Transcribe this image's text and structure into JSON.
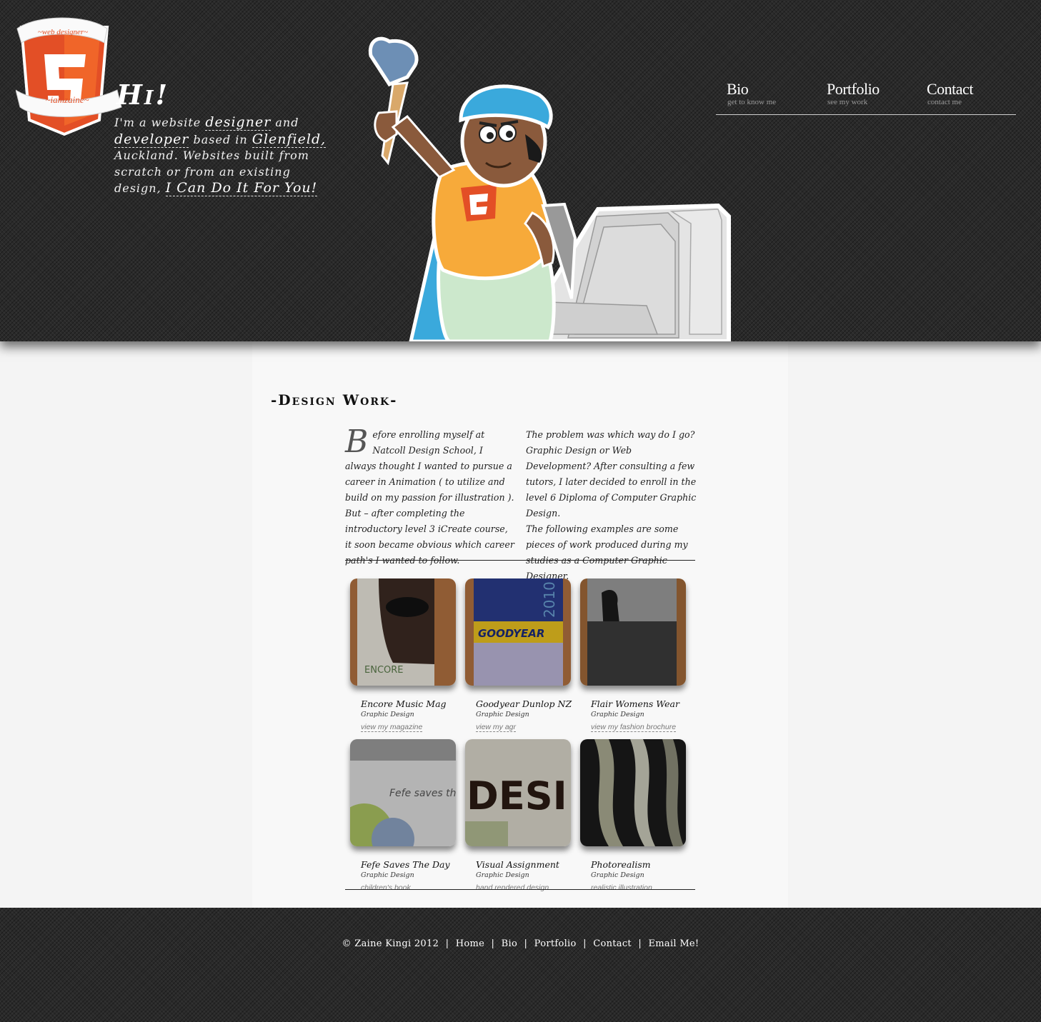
{
  "header": {
    "logo": {
      "ribbon_top": "~web designer~",
      "ribbon_bottom": "~iamzaine~"
    },
    "greeting": "Hi!",
    "intro": {
      "p1": "I'm a website ",
      "designer": "designer",
      "p2": " and ",
      "developer": "developer",
      "p3": " based in ",
      "glenfield": "Glenfield,",
      "p4": " Auckland. Websites built from scratch or from an existing design, ",
      "cta": "I Can Do It For You!"
    }
  },
  "nav": [
    {
      "label": "Bio",
      "sub": "get to know me"
    },
    {
      "label": "Portfolio",
      "sub": "see my work"
    },
    {
      "label": "Contact",
      "sub": "contact me"
    }
  ],
  "section": {
    "title": "-Design Work-",
    "col_left_dropcap": "B",
    "col_left": "efore enrolling myself at Natcoll Design School, I always thought I wanted to pursue a career in Animation ( to utilize and build on my passion for illustration ). But – after completing the introductory level 3 iCreate course, it soon became obvious which career path's I wanted to follow.",
    "col_right_1": "The problem was which way do I go? Graphic Design or Web Development? After consulting a few tutors, I later decided to enroll in the level 6 Diploma of Computer Graphic Design.",
    "col_right_2": "The following examples are some pieces of work produced during my studies as a Computer Graphic Designer."
  },
  "works": [
    {
      "title": "Encore Music Mag",
      "category": "Graphic Design",
      "link": "view my magazine",
      "thumb_text": "ENCORE"
    },
    {
      "title": "Goodyear Dunlop NZ",
      "category": "Graphic Design",
      "link": "view my agr",
      "thumb_text": "GOODYEAR",
      "thumb_year": "2010"
    },
    {
      "title": "Flair Womens Wear",
      "category": "Graphic Design",
      "link": "view my fashion brochure"
    },
    {
      "title": "Fefe Saves The Day",
      "category": "Graphic Design",
      "link": "children's book",
      "thumb_text": "Fefe saves the day"
    },
    {
      "title": "Visual Assignment",
      "category": "Graphic Design",
      "link": "hand rendered design",
      "thumb_text": "DESI"
    },
    {
      "title": "Photorealism",
      "category": "Graphic Design",
      "link": "realistic illustration"
    }
  ],
  "footer": {
    "copyright": "© Zaine Kingi 2012",
    "links": [
      "Home",
      "Bio",
      "Portfolio",
      "Contact",
      "Email Me!"
    ],
    "separator": "|"
  },
  "colors": {
    "header_bg": "#2a2a2a",
    "logo_orange": "#e34f26",
    "content_bg": "#f8f8f8"
  }
}
